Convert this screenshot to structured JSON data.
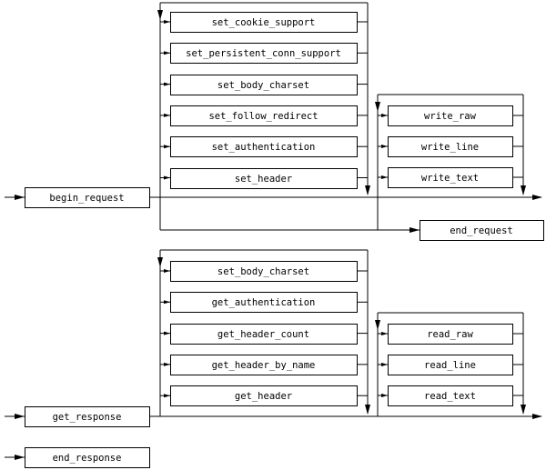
{
  "request": {
    "start": "begin_request",
    "options": [
      "set_cookie_support",
      "set_persistent_conn_support",
      "set_body_charset",
      "set_follow_redirect",
      "set_authentication",
      "set_header"
    ],
    "writers": [
      "write_raw",
      "write_line",
      "write_text"
    ],
    "end": "end_request"
  },
  "response": {
    "start": "get_response",
    "options": [
      "set_body_charset",
      "get_authentication",
      "get_header_count",
      "get_header_by_name",
      "get_header"
    ],
    "readers": [
      "read_raw",
      "read_line",
      "read_text"
    ],
    "end": "end_response"
  },
  "colors": {
    "stroke": "#000000",
    "box_fill": "#ffffff"
  }
}
